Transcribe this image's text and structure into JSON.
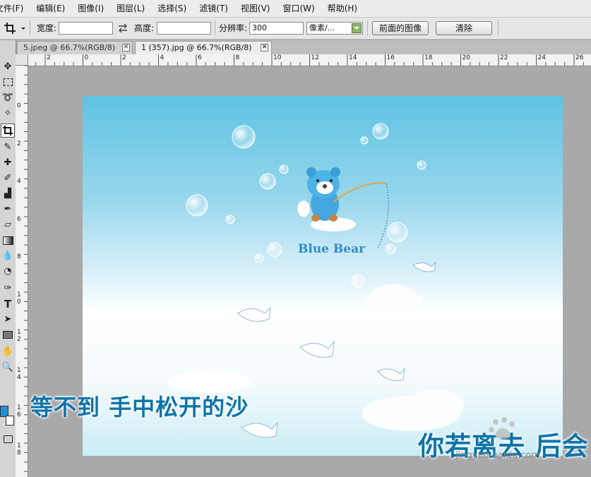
{
  "menu": [
    "文件(F)",
    "编辑(E)",
    "图像(I)",
    "图层(L)",
    "选择(S)",
    "滤镜(T)",
    "视图(V)",
    "窗口(W)",
    "帮助(H)"
  ],
  "options": {
    "width_label": "宽度:",
    "height_label": "高度:",
    "resolution_label": "分辨率:",
    "resolution_value": "300",
    "unit_value": "像素/...",
    "front_image_button": "前面的图像",
    "clear_button": "清除"
  },
  "tabs": [
    {
      "label": "5.jpeg @ 66.7%(RGB/8)",
      "close": "✕",
      "active": false
    },
    {
      "label": "1 (357).jpg @ 66.7%(RGB/8)",
      "close": "✕",
      "active": true
    }
  ],
  "ruler": {
    "h_labels": [
      "2",
      "0",
      "2",
      "4",
      "6",
      "8",
      "10",
      "12",
      "14",
      "16",
      "18",
      "20",
      "22",
      "24",
      "26"
    ],
    "v_labels": [
      "0",
      "2",
      "4",
      "6",
      "8",
      "1\n0",
      "1\n2",
      "1\n4",
      "1\n6",
      "1\n8"
    ]
  },
  "canvas": {
    "brand": "Blue Bear",
    "lyric_line_1": "等不到 手中松开的沙",
    "lyric_line_2": "你若离去 后会"
  },
  "watermark": {
    "text": "jingyan.baidu.com"
  },
  "colors": {
    "foreground": "#1f8fd8",
    "background": "#ffffff"
  }
}
